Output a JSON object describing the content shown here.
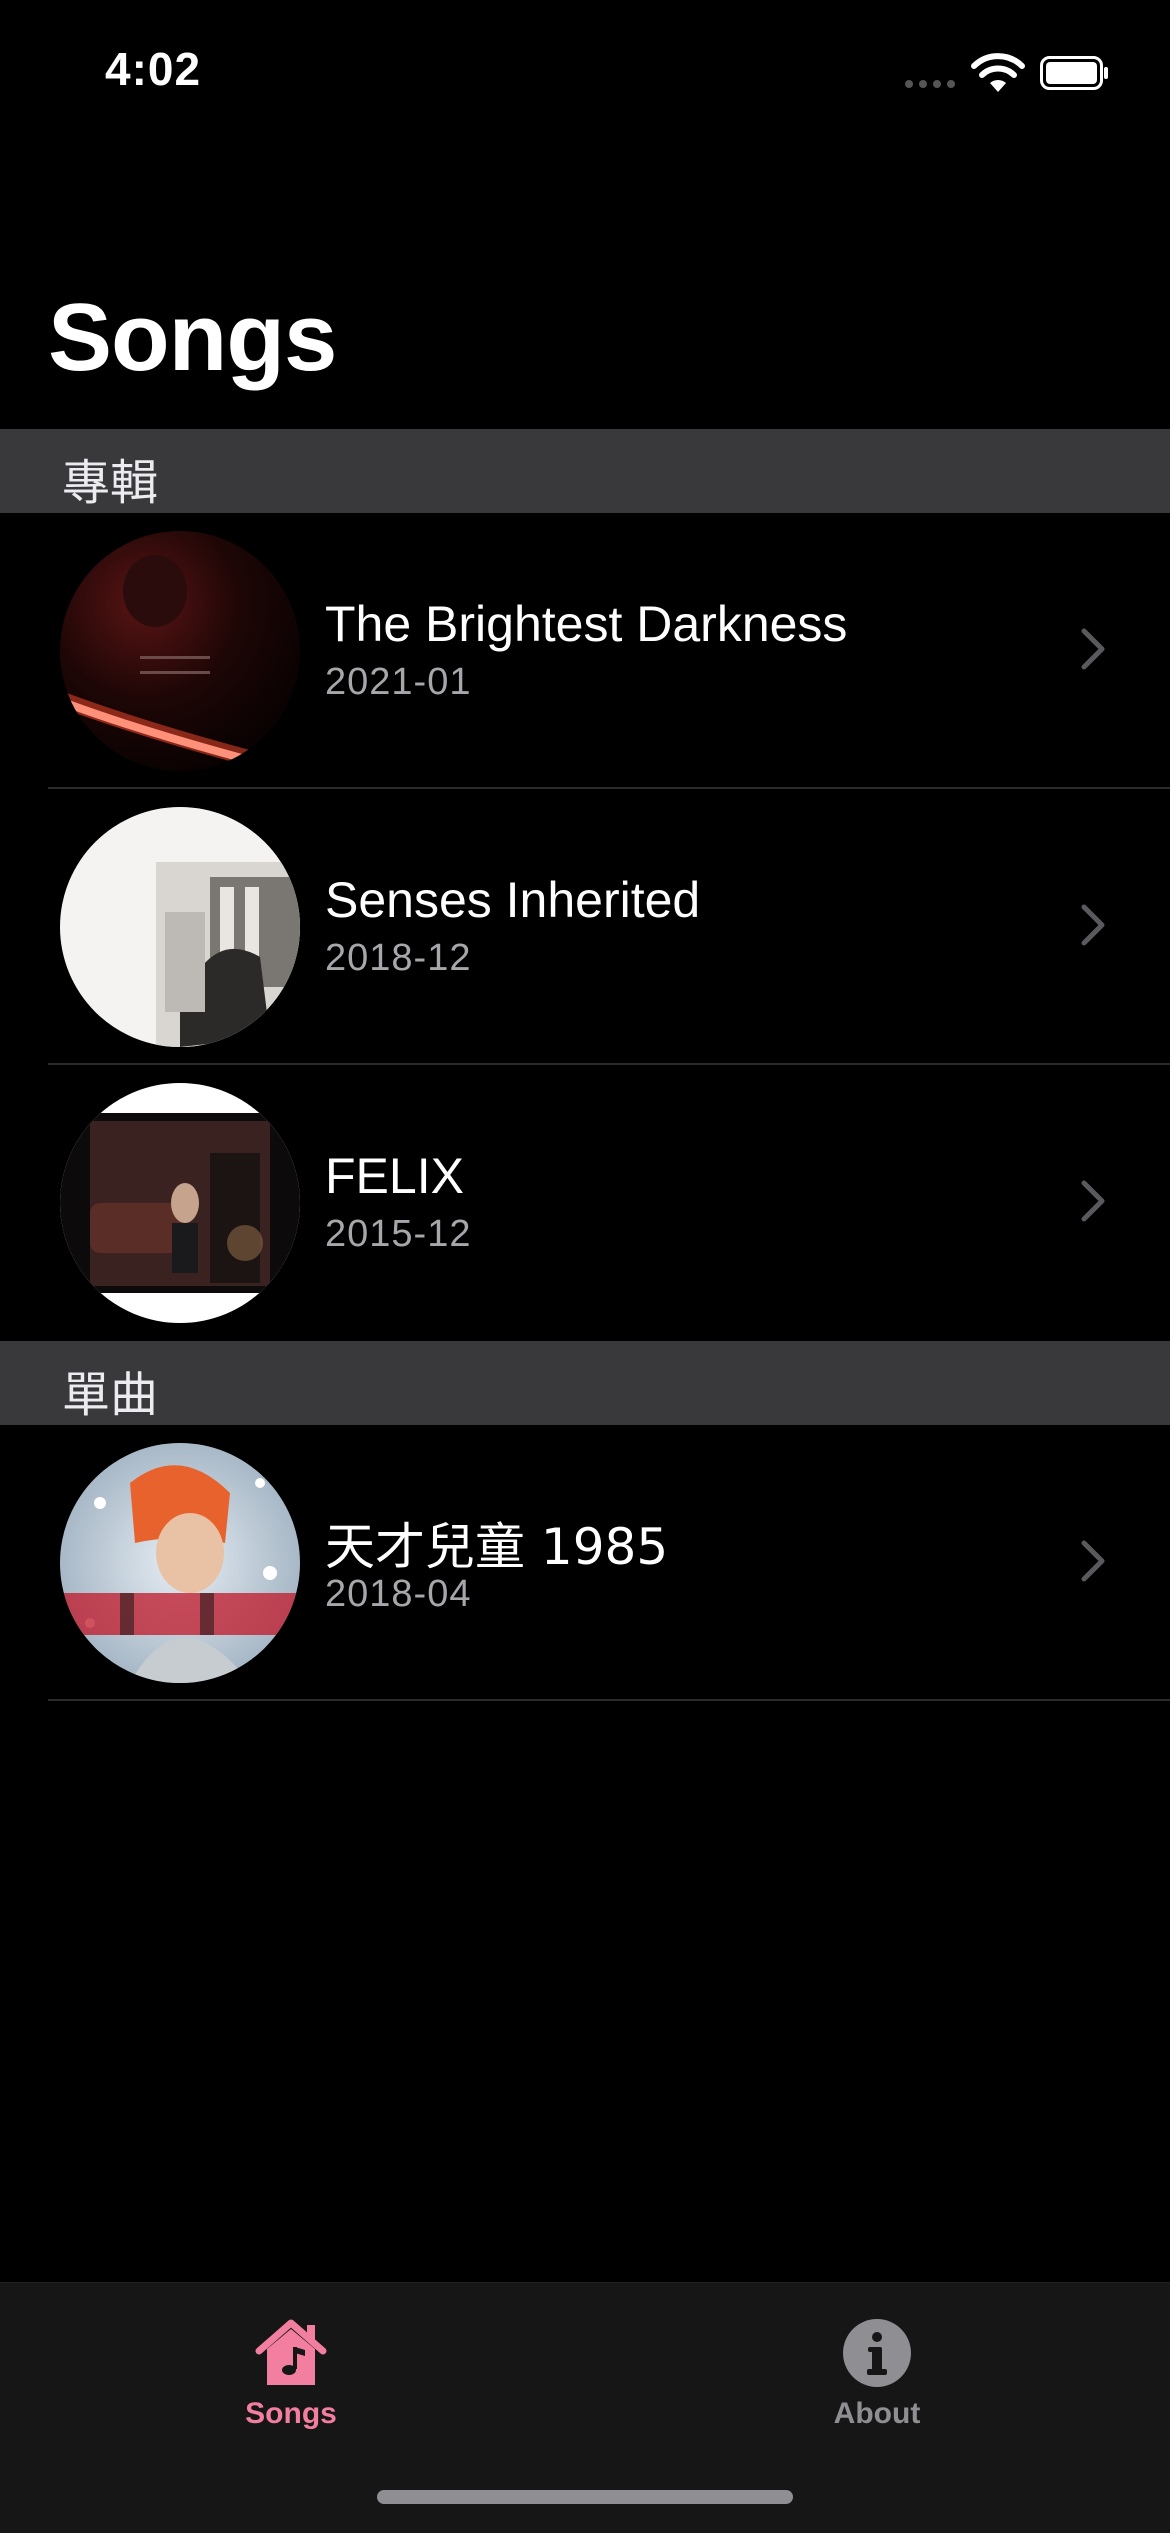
{
  "status_bar": {
    "time": "4:02"
  },
  "nav": {
    "title": "Songs"
  },
  "sections": [
    {
      "header": "專輯",
      "items": [
        {
          "title": "The Brightest Darkness",
          "date": "2021-01",
          "artwork_icon": "album-artwork"
        },
        {
          "title": "Senses Inherited",
          "date": "2018-12",
          "artwork_icon": "album-artwork"
        },
        {
          "title": "FELIX",
          "date": "2015-12",
          "artwork_icon": "album-artwork"
        }
      ]
    },
    {
      "header": "單曲",
      "items": [
        {
          "title": "天才兒童 1985",
          "date": "2018-04",
          "artwork_icon": "single-artwork"
        }
      ]
    }
  ],
  "tab_bar": {
    "tabs": [
      {
        "label": "Songs",
        "icon": "house-music-icon",
        "selected": true
      },
      {
        "label": "About",
        "icon": "info-circle-icon",
        "selected": false
      }
    ]
  },
  "colors": {
    "accent": "#f27ea0",
    "background": "#000000",
    "section_header": "#39393b",
    "secondary_text": "#a6a6ab"
  }
}
